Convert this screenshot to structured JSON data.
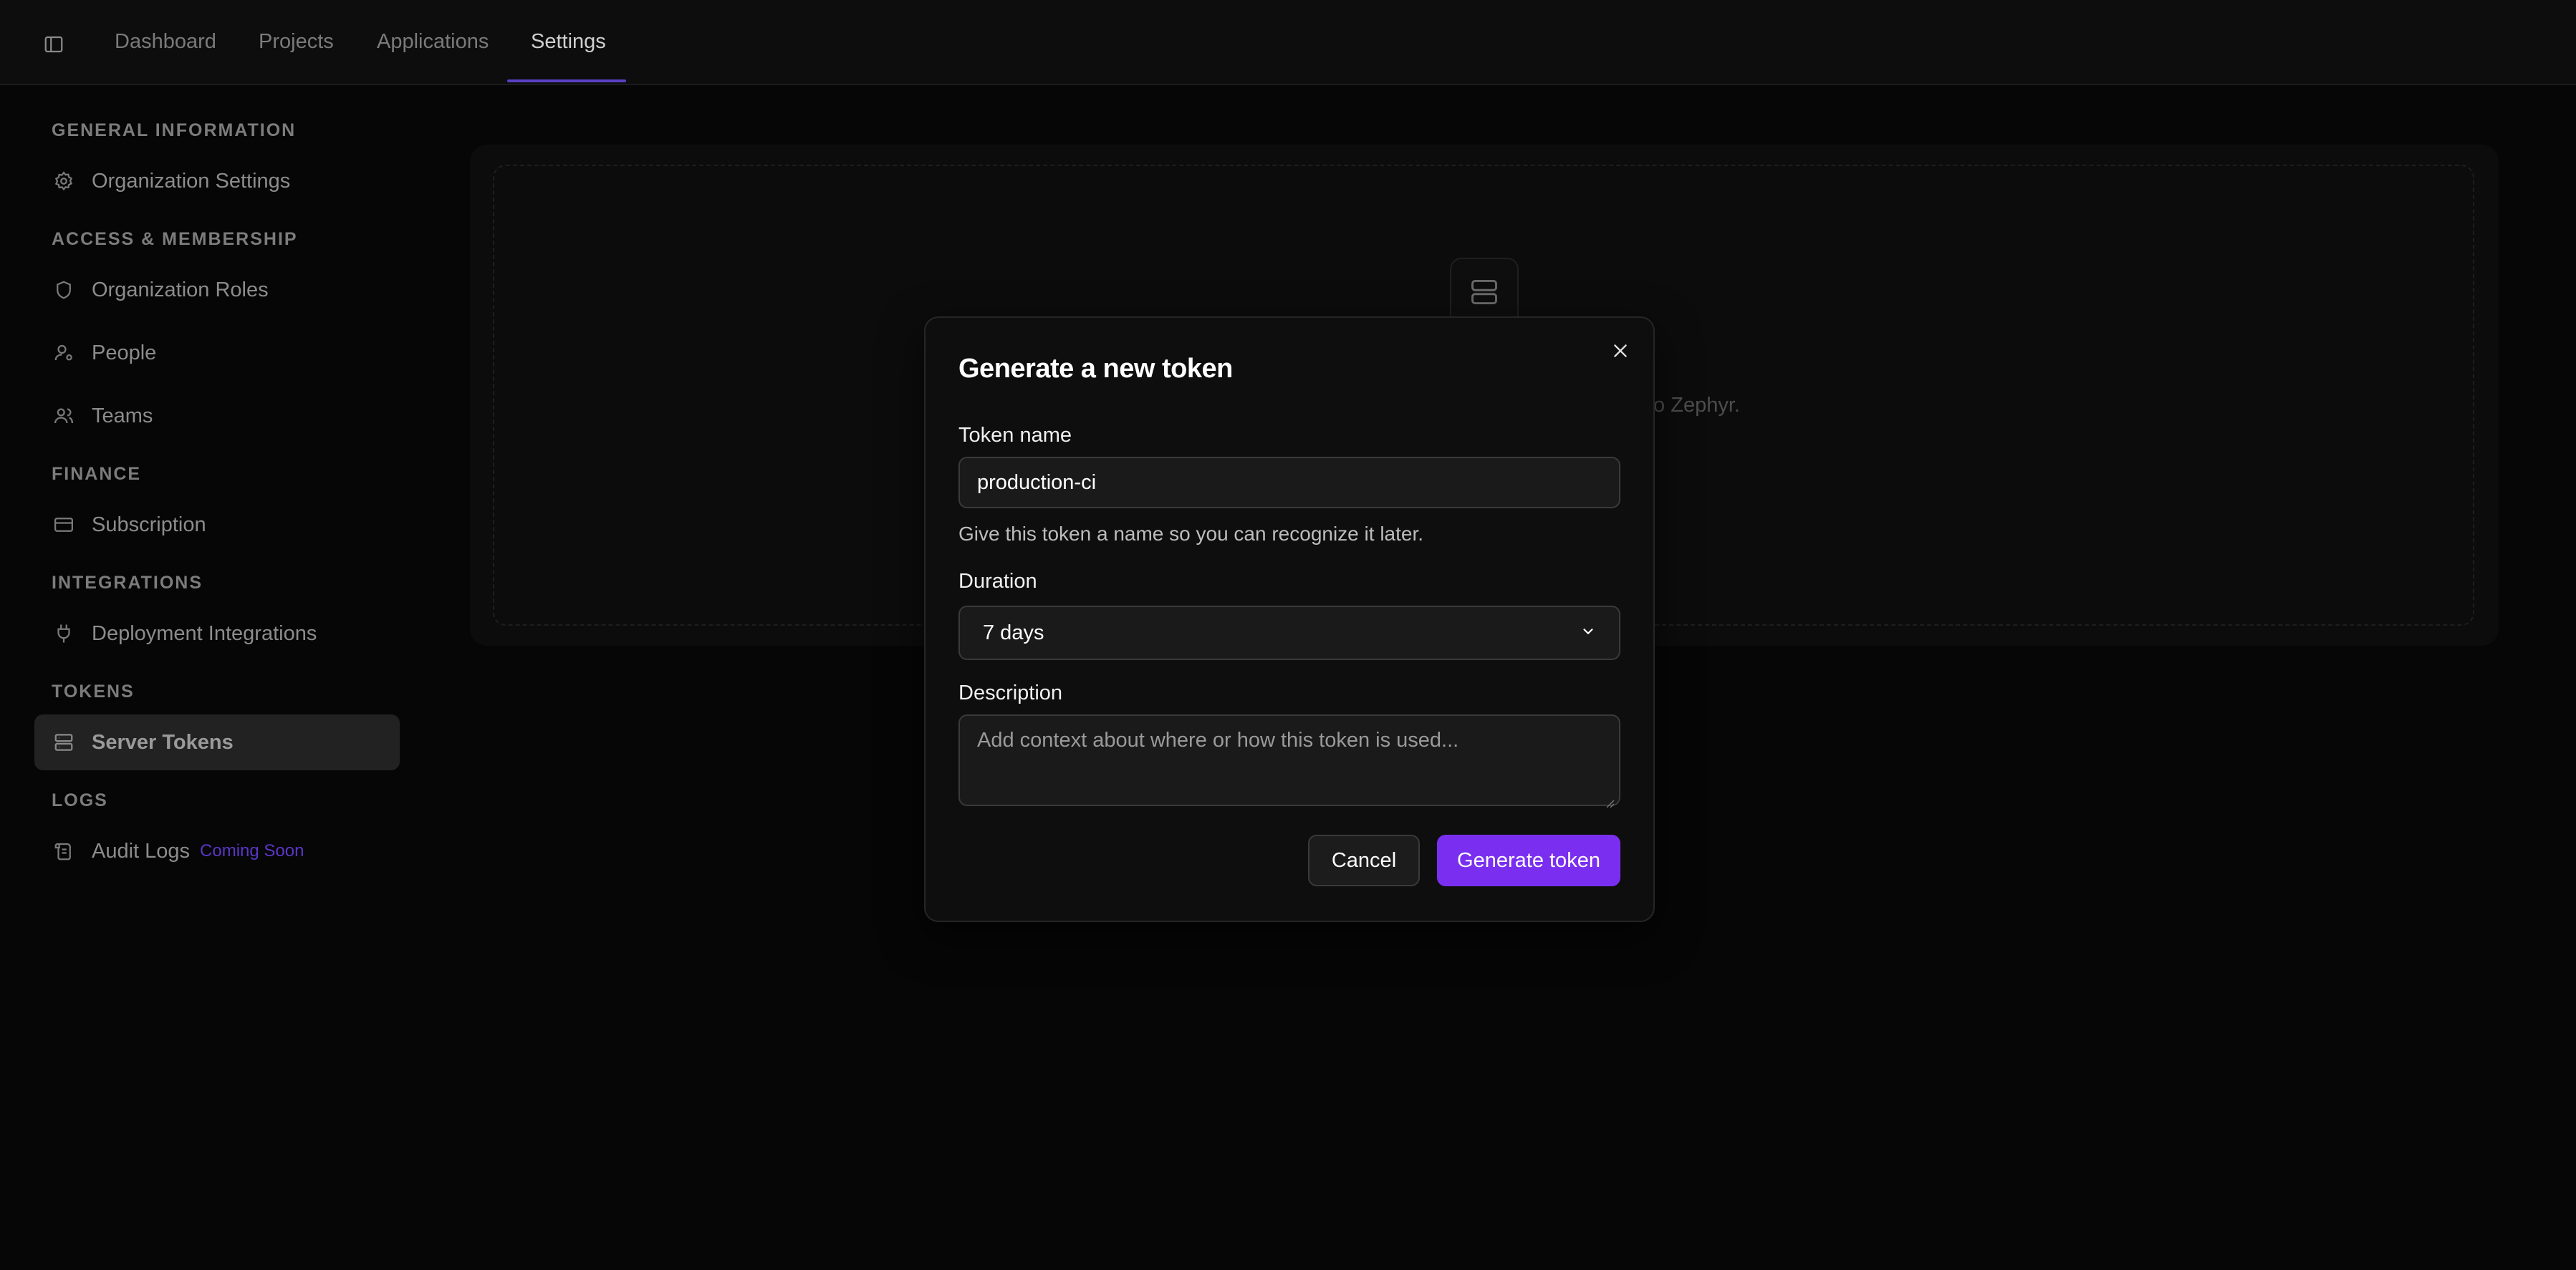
{
  "nav": {
    "toggle_icon": "sidebar-toggle-icon",
    "tabs": [
      {
        "label": "Dashboard"
      },
      {
        "label": "Projects"
      },
      {
        "label": "Applications"
      },
      {
        "label": "Settings",
        "active": true
      }
    ],
    "accent_color": "#5b3fc4"
  },
  "sidebar": {
    "sections": [
      {
        "label": "GENERAL INFORMATION",
        "items": [
          {
            "label": "Organization Settings",
            "icon": "gear-icon"
          }
        ]
      },
      {
        "label": "ACCESS & MEMBERSHIP",
        "items": [
          {
            "label": "Organization Roles",
            "icon": "shield-icon"
          },
          {
            "label": "People",
            "icon": "person-settings-icon"
          },
          {
            "label": "Teams",
            "icon": "users-icon"
          }
        ]
      },
      {
        "label": "FINANCE",
        "items": [
          {
            "label": "Subscription",
            "icon": "credit-card-icon"
          }
        ]
      },
      {
        "label": "INTEGRATIONS",
        "items": [
          {
            "label": "Deployment Integrations",
            "icon": "plug-icon"
          }
        ]
      },
      {
        "label": "TOKENS",
        "items": [
          {
            "label": "Server Tokens",
            "icon": "server-icon",
            "active": true
          }
        ]
      },
      {
        "label": "LOGS",
        "items": [
          {
            "label": "Audit Logs",
            "icon": "scroll-icon",
            "badge": "Coming Soon"
          }
        ]
      }
    ]
  },
  "background": {
    "empty_state_icon": "server-icon",
    "partial_text": "to Zephyr."
  },
  "modal": {
    "title": "Generate a new token",
    "close_icon": "close-icon",
    "token_name": {
      "label": "Token name",
      "value": "production-ci",
      "hint": "Give this token a name so you can recognize it later."
    },
    "duration": {
      "label": "Duration",
      "selected": "7 days"
    },
    "description": {
      "label": "Description",
      "placeholder": "Add context about where or how this token is used..."
    },
    "cancel_label": "Cancel",
    "submit_label": "Generate token",
    "primary_color": "#7a2ff0"
  }
}
